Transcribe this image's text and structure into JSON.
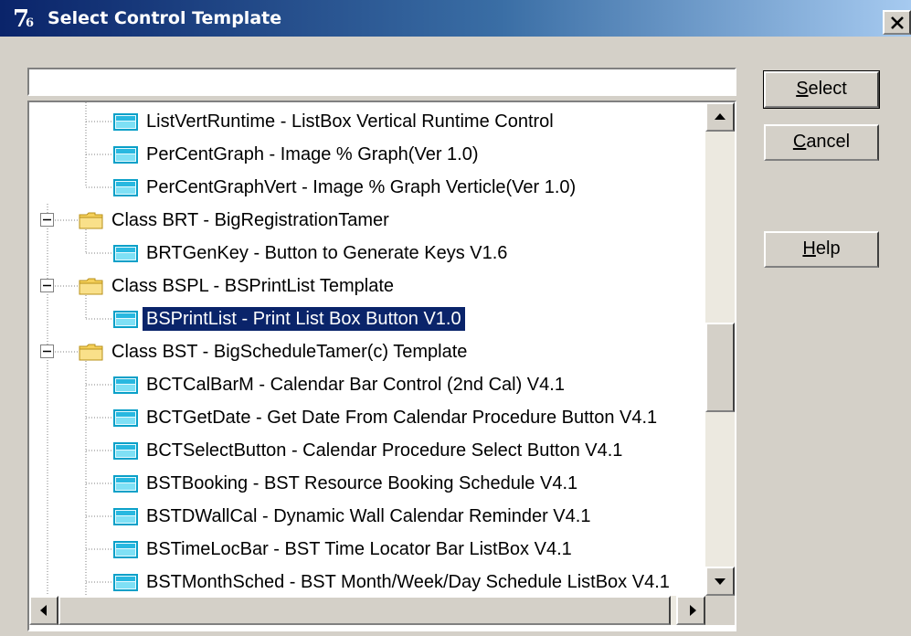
{
  "window": {
    "title": "Select Control Template",
    "icon": "clarion-7-icon",
    "icon_text": "7",
    "icon_subtext": "6"
  },
  "filter": {
    "value": "",
    "placeholder": ""
  },
  "tree": {
    "rows": [
      {
        "label": "ListVertRuntime - ListBox Vertical Runtime Control",
        "kind": "template",
        "level": 1,
        "selected": false
      },
      {
        "label": "PerCentGraph - Image % Graph(Ver 1.0)",
        "kind": "template",
        "level": 1,
        "selected": false
      },
      {
        "label": "PerCentGraphVert - Image % Graph Verticle(Ver 1.0)",
        "kind": "template",
        "level": 1,
        "selected": false
      },
      {
        "label": "Class BRT - BigRegistrationTamer",
        "kind": "class",
        "level": 0,
        "expanded": true,
        "selected": false
      },
      {
        "label": "BRTGenKey - Button to Generate Keys V1.6",
        "kind": "template",
        "level": 1,
        "selected": false
      },
      {
        "label": "Class BSPL - BSPrintList Template",
        "kind": "class",
        "level": 0,
        "expanded": true,
        "selected": false
      },
      {
        "label": "BSPrintList - Print List Box Button V1.0",
        "kind": "template",
        "level": 1,
        "selected": true
      },
      {
        "label": "Class BST - BigScheduleTamer(c) Template",
        "kind": "class",
        "level": 0,
        "expanded": true,
        "selected": false
      },
      {
        "label": "BCTCalBarM - Calendar Bar Control (2nd Cal) V4.1",
        "kind": "template",
        "level": 1,
        "selected": false
      },
      {
        "label": "BCTGetDate - Get Date From Calendar Procedure Button V4.1",
        "kind": "template",
        "level": 1,
        "selected": false
      },
      {
        "label": "BCTSelectButton - Calendar Procedure Select Button V4.1",
        "kind": "template",
        "level": 1,
        "selected": false
      },
      {
        "label": "BSTBooking - BST Resource Booking Schedule V4.1",
        "kind": "template",
        "level": 1,
        "selected": false
      },
      {
        "label": "BSTDWallCal - Dynamic Wall Calendar Reminder V4.1",
        "kind": "template",
        "level": 1,
        "selected": false
      },
      {
        "label": "BSTimeLocBar - BST Time Locator Bar ListBox V4.1",
        "kind": "template",
        "level": 1,
        "selected": false
      },
      {
        "label": "BSTMonthSched - BST Month/Week/Day Schedule ListBox V4.1",
        "kind": "template",
        "level": 1,
        "selected": false
      }
    ],
    "vertical_scroll_position": 0.5
  },
  "buttons": {
    "select": {
      "pre": "",
      "accel": "S",
      "post": "elect"
    },
    "cancel": {
      "pre": "",
      "accel": "C",
      "post": "ancel"
    },
    "help": {
      "pre": "",
      "accel": "H",
      "post": "elp"
    }
  },
  "colors": {
    "selection": "#0a246a",
    "title_gradient_start": "#0a246a",
    "title_gradient_end": "#a6caf0",
    "dialog_face": "#d4d0c8"
  }
}
